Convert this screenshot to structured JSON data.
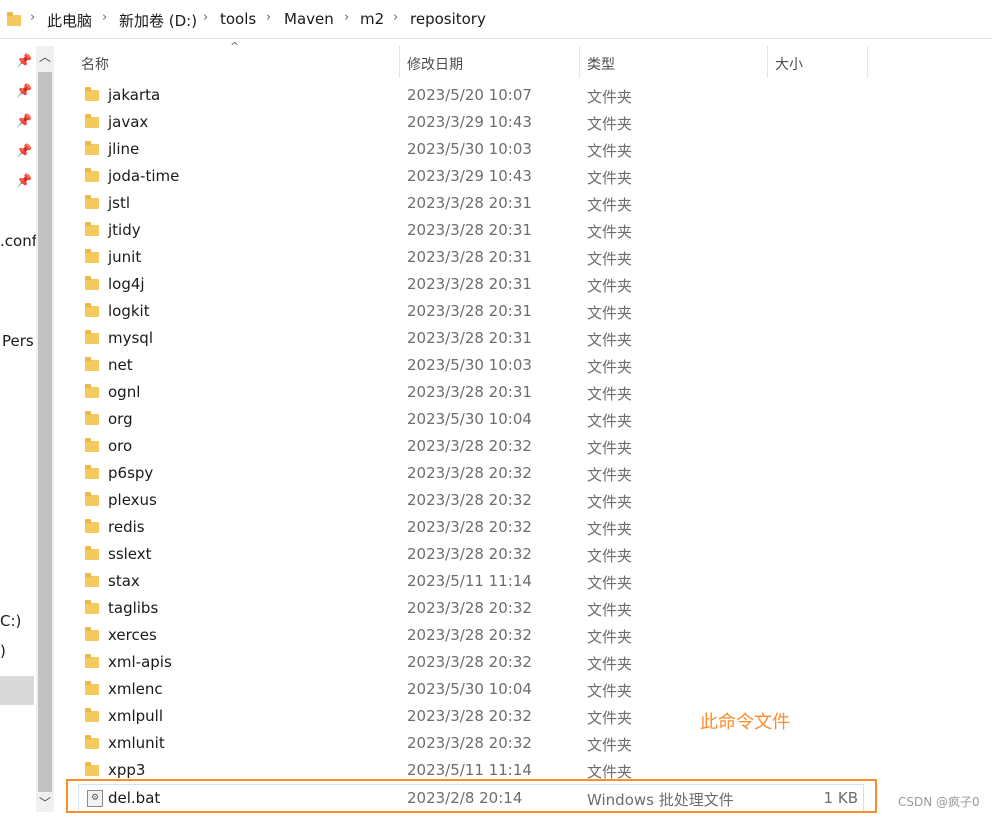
{
  "breadcrumb": [
    "此电脑",
    "新加卷 (D:)",
    "tools",
    "Maven",
    "m2",
    "repository"
  ],
  "nav_partial": [
    ".conf",
    "Pers",
    "C:)",
    ")"
  ],
  "columns": {
    "name": "名称",
    "date": "修改日期",
    "type": "类型",
    "size": "大小"
  },
  "rows": [
    {
      "name": "jakarta",
      "date": "2023/5/20 10:07",
      "type": "文件夹"
    },
    {
      "name": "javax",
      "date": "2023/3/29 10:43",
      "type": "文件夹"
    },
    {
      "name": "jline",
      "date": "2023/5/30 10:03",
      "type": "文件夹"
    },
    {
      "name": "joda-time",
      "date": "2023/3/29 10:43",
      "type": "文件夹"
    },
    {
      "name": "jstl",
      "date": "2023/3/28 20:31",
      "type": "文件夹"
    },
    {
      "name": "jtidy",
      "date": "2023/3/28 20:31",
      "type": "文件夹"
    },
    {
      "name": "junit",
      "date": "2023/3/28 20:31",
      "type": "文件夹"
    },
    {
      "name": "log4j",
      "date": "2023/3/28 20:31",
      "type": "文件夹"
    },
    {
      "name": "logkit",
      "date": "2023/3/28 20:31",
      "type": "文件夹"
    },
    {
      "name": "mysql",
      "date": "2023/3/28 20:31",
      "type": "文件夹"
    },
    {
      "name": "net",
      "date": "2023/5/30 10:03",
      "type": "文件夹"
    },
    {
      "name": "ognl",
      "date": "2023/3/28 20:31",
      "type": "文件夹"
    },
    {
      "name": "org",
      "date": "2023/5/30 10:04",
      "type": "文件夹"
    },
    {
      "name": "oro",
      "date": "2023/3/28 20:32",
      "type": "文件夹"
    },
    {
      "name": "p6spy",
      "date": "2023/3/28 20:32",
      "type": "文件夹"
    },
    {
      "name": "plexus",
      "date": "2023/3/28 20:32",
      "type": "文件夹"
    },
    {
      "name": "redis",
      "date": "2023/3/28 20:32",
      "type": "文件夹"
    },
    {
      "name": "sslext",
      "date": "2023/3/28 20:32",
      "type": "文件夹"
    },
    {
      "name": "stax",
      "date": "2023/5/11 11:14",
      "type": "文件夹"
    },
    {
      "name": "taglibs",
      "date": "2023/3/28 20:32",
      "type": "文件夹"
    },
    {
      "name": "xerces",
      "date": "2023/3/28 20:32",
      "type": "文件夹"
    },
    {
      "name": "xml-apis",
      "date": "2023/3/28 20:32",
      "type": "文件夹"
    },
    {
      "name": "xmlenc",
      "date": "2023/5/30 10:04",
      "type": "文件夹"
    },
    {
      "name": "xmlpull",
      "date": "2023/3/28 20:32",
      "type": "文件夹"
    },
    {
      "name": "xmlunit",
      "date": "2023/3/28 20:32",
      "type": "文件夹"
    },
    {
      "name": "xpp3",
      "date": "2023/5/11 11:14",
      "type": "文件夹"
    }
  ],
  "bat_file": {
    "name": "del.bat",
    "date": "2023/2/8 20:14",
    "type": "Windows 批处理文件",
    "size": "1 KB"
  },
  "annotation": "此命令文件",
  "watermark": "CSDN @疯子0",
  "colors": {
    "highlight": "#ff8c2b",
    "folder": "#f4c95d"
  }
}
